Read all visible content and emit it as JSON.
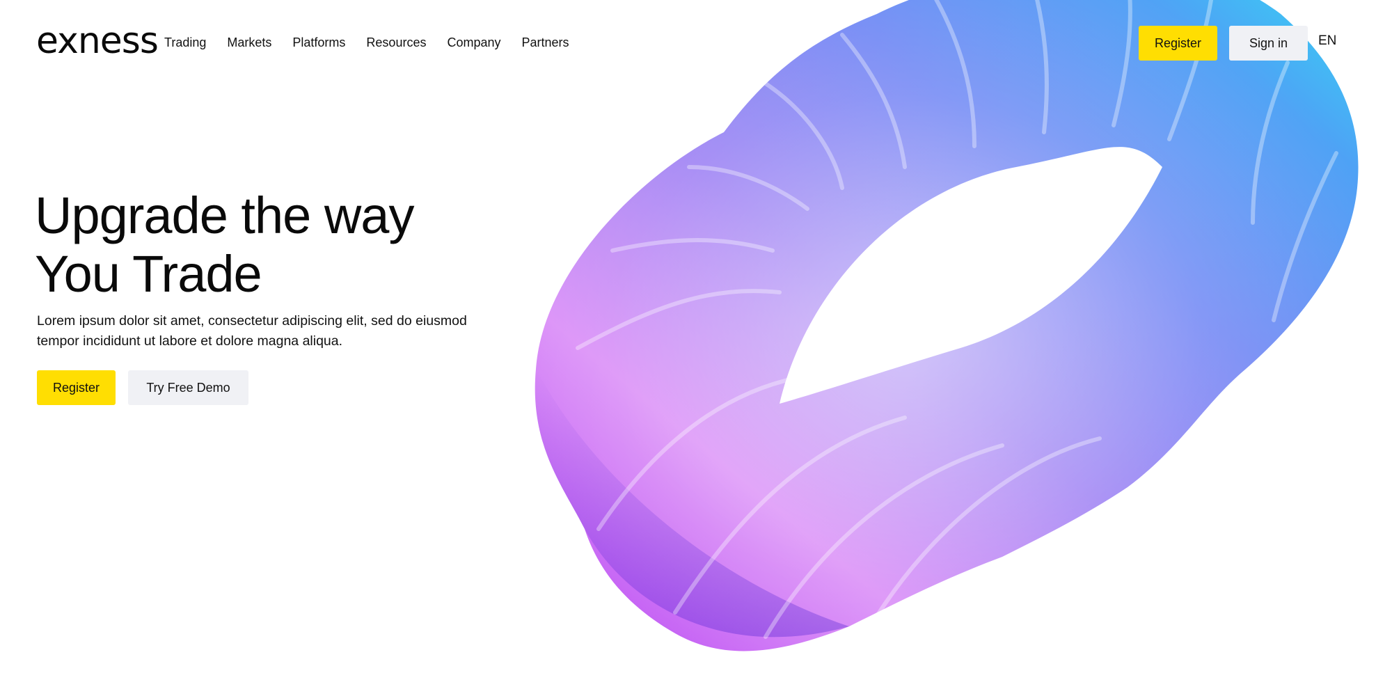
{
  "brand": {
    "logo_text": "exness"
  },
  "nav": {
    "items": [
      "Trading",
      "Markets",
      "Platforms",
      "Resources",
      "Company",
      "Partners"
    ]
  },
  "header": {
    "register_label": "Register",
    "signin_label": "Sign in",
    "language": "EN"
  },
  "hero": {
    "title_line1": "Upgrade the way",
    "title_line2": "You Trade",
    "subtitle_line1": "Lorem ipsum dolor sit amet, consectetur adipiscing elit, sed do eiusmod",
    "subtitle_line2": "tempor incididunt ut labore et dolore magna aliqua.",
    "register_label": "Register",
    "demo_label": "Try Free Demo"
  },
  "colors": {
    "accent_yellow": "#ffde02",
    "secondary_button": "#f0f1f5",
    "text": "#0a0a0a",
    "art_gradient": [
      "#c86bf5",
      "#8a5cf7",
      "#5b7cf5",
      "#3fa6f4",
      "#36d6f2"
    ]
  }
}
